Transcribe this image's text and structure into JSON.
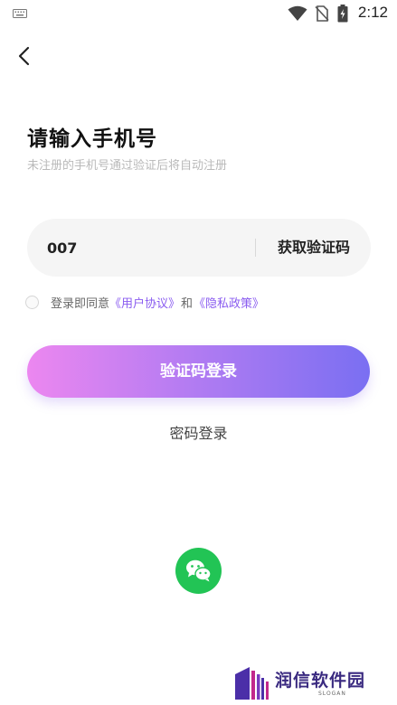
{
  "status_bar": {
    "time": "2:12",
    "icons": [
      "keyboard-icon",
      "wifi-icon",
      "no-sim-icon",
      "battery-charging-icon"
    ]
  },
  "header": {
    "back_icon": "chevron-left-icon"
  },
  "title": "请输入手机号",
  "subtitle": "未注册的手机号通过验证后将自动注册",
  "phone": {
    "value": "007",
    "get_code_label": "获取验证码"
  },
  "agreement": {
    "checked": false,
    "prefix": "登录即同意",
    "user_agreement": "《用户协议》",
    "and": "和",
    "privacy_policy": "《隐私政策》"
  },
  "login_button": "验证码登录",
  "password_login": "密码登录",
  "wechat": {
    "icon": "wechat-icon"
  },
  "watermark": {
    "text": "润信软件园",
    "slogan": "SLOGAN"
  },
  "colors": {
    "gradient_start": "#ec87f0",
    "gradient_end": "#7a6ff2",
    "link": "#8a5cf0",
    "wechat_green": "#22c455"
  }
}
